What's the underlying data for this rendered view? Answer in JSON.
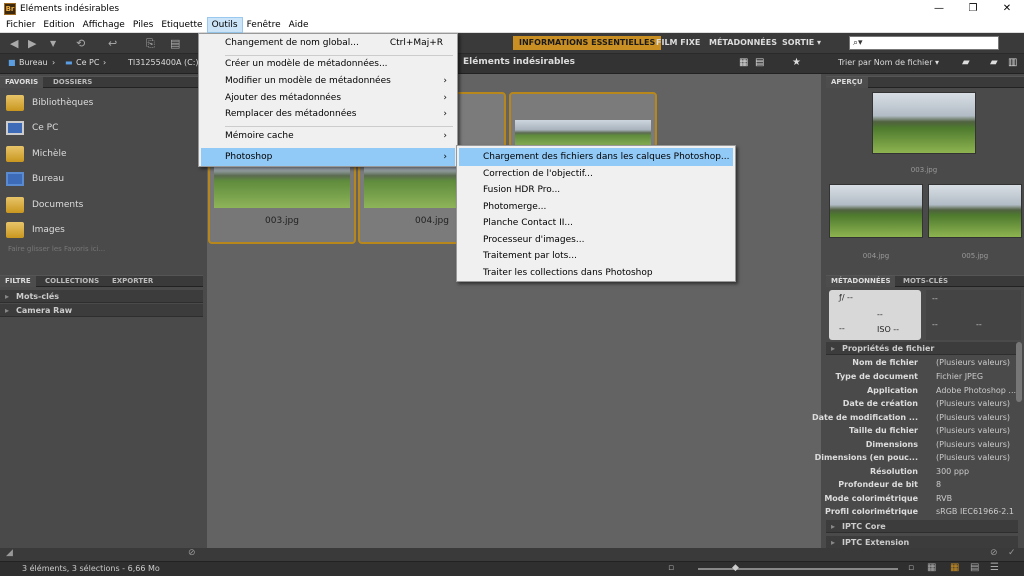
{
  "window": {
    "title": "Eléments indésirables",
    "app_icon": "Br",
    "controls": {
      "minimize": "—",
      "maximize": "❐",
      "close": "✕"
    }
  },
  "menubar": [
    "Fichier",
    "Edition",
    "Affichage",
    "Piles",
    "Etiquette",
    "Outils",
    "Fenêtre",
    "Aide"
  ],
  "workspaces": [
    "INFORMATIONS ESSENTIELLES",
    "FILM FIXE",
    "MÉTADONNÉES",
    "SORTIE ▾"
  ],
  "search": {
    "value": "",
    "placeholder": "⌕▾"
  },
  "breadcrumb": {
    "items": [
      "Bureau",
      "Ce PC",
      "TI31255400A (C:)"
    ],
    "folder": "Eléments indésirables"
  },
  "sort_label": "Trier par Nom de fichier ▾",
  "left": {
    "tabs": [
      "FAVORIS",
      "DOSSIERS"
    ],
    "favorites": [
      "Bibliothèques",
      "Ce PC",
      "Michèle",
      "Bureau",
      "Documents",
      "Images"
    ],
    "hint": "Faire glisser les Favoris ici...",
    "filter_tabs": [
      "FILTRE",
      "COLLECTIONS",
      "EXPORTER"
    ],
    "filters": [
      "Mots-clés",
      "Camera Raw"
    ]
  },
  "thumbs": [
    {
      "label": "003.jpg"
    },
    {
      "label": "004.jpg"
    }
  ],
  "right": {
    "preview_tab": "APERÇU",
    "previews": [
      "003.jpg",
      "004.jpg",
      "005.jpg"
    ],
    "meta_tabs": [
      "MÉTADONNÉES",
      "MOTS-CLÉS"
    ],
    "exif": {
      "f": "ƒ/ --",
      "iso": "ISO --",
      "d": "--"
    },
    "props_title": "Propriétés de fichier",
    "props": [
      {
        "k": "Nom de fichier",
        "v": "(Plusieurs valeurs)"
      },
      {
        "k": "Type de document",
        "v": "Fichier JPEG"
      },
      {
        "k": "Application",
        "v": "Adobe Photoshop ..."
      },
      {
        "k": "Date de création",
        "v": "(Plusieurs valeurs)"
      },
      {
        "k": "Date de modification ...",
        "v": "(Plusieurs valeurs)"
      },
      {
        "k": "Taille du fichier",
        "v": "(Plusieurs valeurs)"
      },
      {
        "k": "Dimensions",
        "v": "(Plusieurs valeurs)"
      },
      {
        "k": "Dimensions (en pouc...",
        "v": "(Plusieurs valeurs)"
      },
      {
        "k": "Résolution",
        "v": "300 ppp"
      },
      {
        "k": "Profondeur de bit",
        "v": "8"
      },
      {
        "k": "Mode colorimétrique",
        "v": "RVB"
      },
      {
        "k": "Profil colorimétrique",
        "v": "sRGB IEC61966-2.1"
      }
    ],
    "sections": [
      "IPTC Core",
      "IPTC Extension"
    ]
  },
  "status": "3 éléments, 3 sélections - 6,66 Mo",
  "outils_menu": [
    {
      "label": "Changement de nom global...",
      "shortcut": "Ctrl+Maj+R"
    },
    {
      "label": "Créer un modèle de métadonnées..."
    },
    {
      "label": "Modifier un modèle de métadonnées",
      "arrow": "›"
    },
    {
      "label": "Ajouter des métadonnées",
      "arrow": "›"
    },
    {
      "label": "Remplacer des métadonnées",
      "arrow": "›"
    },
    {
      "label": "Mémoire cache",
      "arrow": "›"
    },
    {
      "label": "Photoshop",
      "arrow": "›"
    }
  ],
  "photoshop_menu": [
    "Chargement des fichiers dans les calques Photoshop...",
    "Correction de l'objectif...",
    "Fusion HDR Pro...",
    "Photomerge...",
    "Planche Contact II...",
    "Processeur d'images...",
    "Traitement par lots...",
    "Traiter les collections dans Photoshop"
  ],
  "colors": {
    "accent": "#c98f23",
    "highlight": "#91c9f7",
    "selection_border": "#b7871c"
  }
}
